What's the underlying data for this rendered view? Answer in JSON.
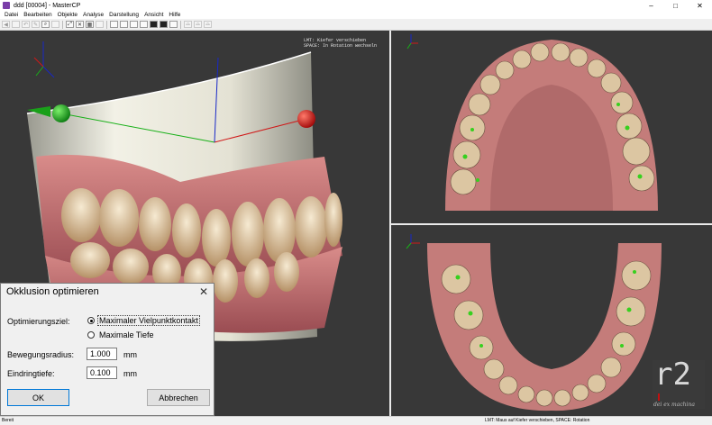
{
  "window": {
    "title": "ddd [00004] - MasterCP",
    "controls": [
      "–",
      "□",
      "✕"
    ]
  },
  "menu": [
    "Datei",
    "Bearbeiten",
    "Objekte",
    "Analyse",
    "Darstellung",
    "Ansicht",
    "Hilfe"
  ],
  "viewport_main": {
    "hint": "LMT: Kiefer verschieben\nSPACE: In Rotation wechseln"
  },
  "statusbar": {
    "left": "Bereit",
    "middle": "LMT: Maus auf Kiefer verschieben, SPACE: Rotation"
  },
  "dialog": {
    "title": "Okklusion optimieren",
    "goal_label": "Optimierungsziel:",
    "option1": "Maximaler Vielpunktkontakt",
    "option2": "Maximale Tiefe",
    "selected": "option1",
    "radius_label": "Bewegungsradius:",
    "radius_value": "1.000",
    "radius_unit": "mm",
    "depth_label": "Eindringtiefe:",
    "depth_value": "0.100",
    "depth_unit": "mm",
    "ok": "OK",
    "cancel": "Abbrechen"
  },
  "logo": {
    "text": "r2",
    "tagline": "dei ex machina"
  },
  "colors": {
    "viewport_bg": "#383838",
    "axis_x": "#d01818",
    "axis_y": "#18b018",
    "axis_z": "#1828c8",
    "gum": "#b8646a",
    "tooth": "#e6d2b0",
    "contact": "#36d01e"
  }
}
